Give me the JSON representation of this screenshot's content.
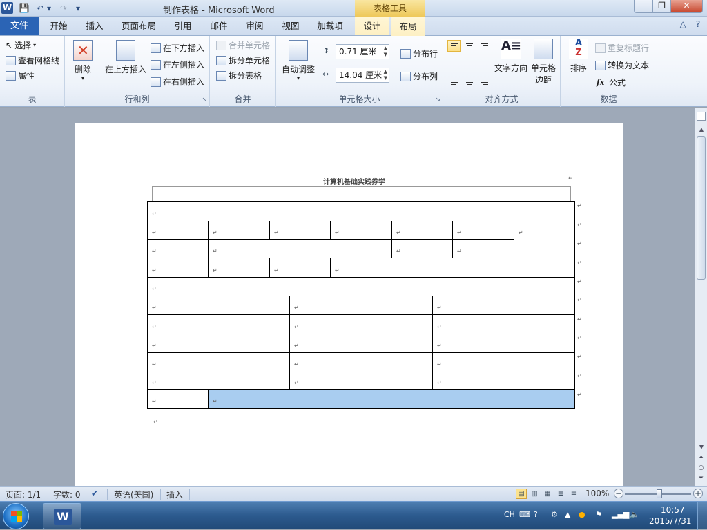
{
  "window": {
    "app_icon": "W",
    "title": "制作表格 - Microsoft Word",
    "context_tab_header": "表格工具"
  },
  "titlebar_buttons": {
    "minimize": "—",
    "maximize": "❐",
    "close": "✕"
  },
  "quick_access": {
    "save_icon": "💾",
    "undo_icon": "↶",
    "redo_icon": "↷",
    "customize_icon": "▾"
  },
  "tabs": [
    "文件",
    "开始",
    "插入",
    "页面布局",
    "引用",
    "邮件",
    "审阅",
    "视图",
    "加载项",
    "设计",
    "布局"
  ],
  "ribbon_right": {
    "help_collapse": "△",
    "help": "?"
  },
  "ribbon": {
    "table_group": {
      "label": "表",
      "select": "选择",
      "view_gridlines": "查看网格线",
      "properties": "属性"
    },
    "rows_cols_group": {
      "label": "行和列",
      "delete": "删除",
      "insert_above": "在上方插入",
      "insert_below": "在下方插入",
      "insert_left": "在左侧插入",
      "insert_right": "在右侧插入"
    },
    "merge_group": {
      "label": "合并",
      "merge_cells": "合并单元格",
      "split_cells": "拆分单元格",
      "split_table": "拆分表格"
    },
    "cell_size_group": {
      "label": "单元格大小",
      "autofit": "自动调整",
      "height_value": "0.71 厘米",
      "width_value": "14.04 厘米",
      "distribute_rows": "分布行",
      "distribute_cols": "分布列"
    },
    "alignment_group": {
      "label": "对齐方式",
      "text_direction": "文字方向",
      "cell_margins_line1": "单元格",
      "cell_margins_line2": "边距"
    },
    "data_group": {
      "label": "数据",
      "sort": "排序",
      "repeat_header": "重复标题行",
      "convert_to_text": "转换为文本",
      "formula": "公式",
      "formula_icon": "fx"
    }
  },
  "document": {
    "header_title": "计算机基础实践券学",
    "paragraph_mark": "↵"
  },
  "statusbar": {
    "page": "页面: 1/1",
    "words": "字数: 0",
    "language": "英语(美国)",
    "mode": "插入",
    "zoom": "100%"
  },
  "taskbar": {
    "lang": "CH",
    "time": "10:57",
    "date": "2015/7/31"
  }
}
